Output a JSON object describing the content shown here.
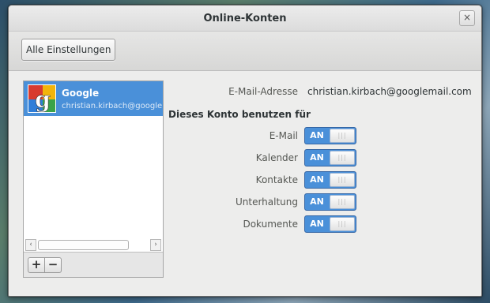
{
  "window": {
    "title": "Online-Konten",
    "close_icon": "×"
  },
  "toolbar": {
    "all_settings_label": "Alle Einstellungen"
  },
  "accounts": [
    {
      "name": "Google",
      "email": "christian.kirbach@googlemail.com",
      "logo": "google-g-logo"
    }
  ],
  "list_controls": {
    "add_label": "+",
    "remove_label": "−",
    "scroll_left": "‹",
    "scroll_right": "›"
  },
  "details": {
    "email_label": "E-Mail-Adresse",
    "email_value": "christian.kirbach@googlemail.com",
    "section_title": "Dieses Konto benutzen für",
    "services": [
      {
        "label": "E-Mail",
        "state": "AN"
      },
      {
        "label": "Kalender",
        "state": "AN"
      },
      {
        "label": "Kontakte",
        "state": "AN"
      },
      {
        "label": "Unterhaltung",
        "state": "AN"
      },
      {
        "label": "Dokumente",
        "state": "AN"
      }
    ],
    "switch_grip": "|||"
  },
  "colors": {
    "accent": "#4a90d9",
    "window_bg": "#ededec"
  }
}
